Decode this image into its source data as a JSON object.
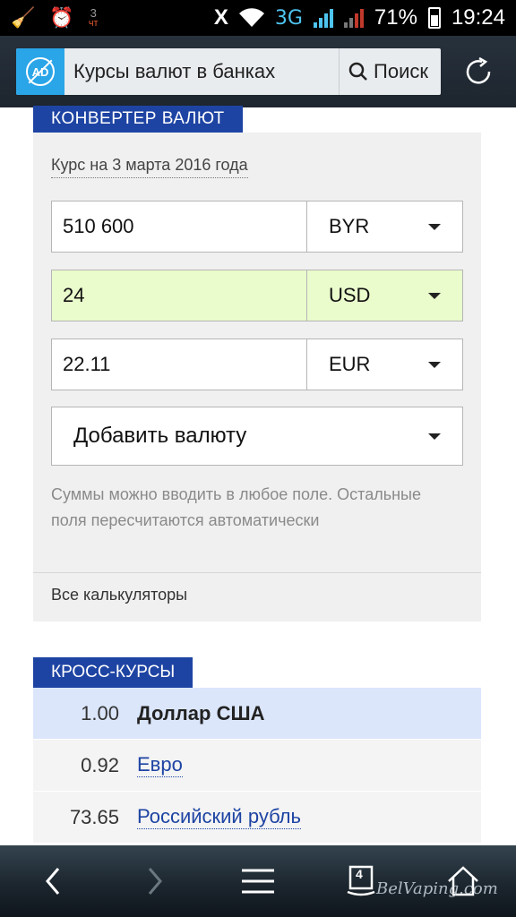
{
  "status_bar": {
    "date_day": "3",
    "date_weekday": "чт",
    "network": "3G",
    "battery": "71%",
    "time": "19:24"
  },
  "browser": {
    "ad_label": "AD",
    "site_title": "Курсы валют в банках",
    "search_label": "Поиск",
    "tab_count": "4"
  },
  "converter": {
    "section_title": "КОНВЕРТЕР ВАЛЮТ",
    "rate_date": "Курс на 3 марта 2016 года",
    "rows": [
      {
        "amount": "510 600",
        "currency": "BYR"
      },
      {
        "amount": "24",
        "currency": "USD"
      },
      {
        "amount": "22.11",
        "currency": "EUR"
      }
    ],
    "add_currency": "Добавить валюту",
    "hint": "Суммы можно вводить в любое поле. Остальные поля пересчитаются автоматически",
    "all_calculators": "Все калькуляторы"
  },
  "cross_rates": {
    "section_title": "КРОСС-КУРСЫ",
    "rows": [
      {
        "value": "1.00",
        "name": "Доллар США"
      },
      {
        "value": "0.92",
        "name": "Евро"
      },
      {
        "value": "73.65",
        "name": "Российский рубль"
      }
    ]
  },
  "watermark": "BelVaping.com",
  "colors": {
    "accent": "#1e44a3",
    "active_row": "#eafbcc",
    "highlight_row": "#dbe6fb",
    "ad_badge": "#2aa5e8"
  }
}
